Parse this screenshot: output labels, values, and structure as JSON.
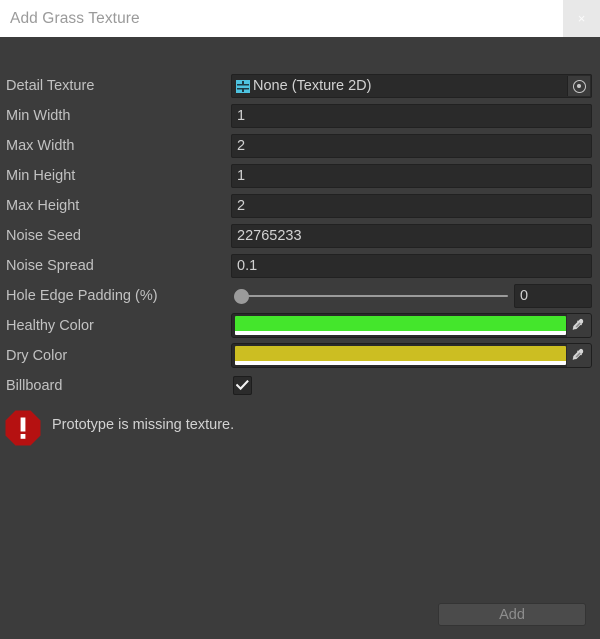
{
  "window": {
    "title": "Add Grass Texture",
    "close_icon": "close-icon",
    "close_label": "×"
  },
  "fields": {
    "detail_texture": {
      "label": "Detail Texture",
      "value": "None (Texture 2D)",
      "icon": "texture-2d-icon",
      "picker_icon": "object-picker-icon"
    },
    "min_width": {
      "label": "Min Width",
      "value": "1"
    },
    "max_width": {
      "label": "Max Width",
      "value": "2"
    },
    "min_height": {
      "label": "Min Height",
      "value": "1"
    },
    "max_height": {
      "label": "Max Height",
      "value": "2"
    },
    "noise_seed": {
      "label": "Noise Seed",
      "value": "22765233"
    },
    "noise_spread": {
      "label": "Noise Spread",
      "value": "0.1"
    },
    "hole_edge_padding": {
      "label": "Hole Edge Padding (%)",
      "value": "0",
      "slider_min": 0,
      "slider_max": 100,
      "slider_position_percent": 0
    },
    "healthy_color": {
      "label": "Healthy Color",
      "color": "#44e62c",
      "alpha_color": "#ffffff",
      "eyedropper_icon": "eyedropper-icon"
    },
    "dry_color": {
      "label": "Dry Color",
      "color": "#ccbe22",
      "alpha_color": "#ffffff",
      "eyedropper_icon": "eyedropper-icon"
    },
    "billboard": {
      "label": "Billboard",
      "checked": true,
      "check_icon": "checkmark-icon"
    }
  },
  "message": {
    "icon": "error-octagon-icon",
    "text": "Prototype is missing texture.",
    "icon_color": "#b51111"
  },
  "footer": {
    "add_label": "Add",
    "add_enabled": false
  },
  "colors": {
    "window_background": "#3c3c3c",
    "titlebar_background": "#ffffff",
    "field_background": "#2a2a2a",
    "label_text": "#c2c2c2",
    "value_text": "#d2d2d2",
    "texture_icon": "#4ec3e0"
  }
}
